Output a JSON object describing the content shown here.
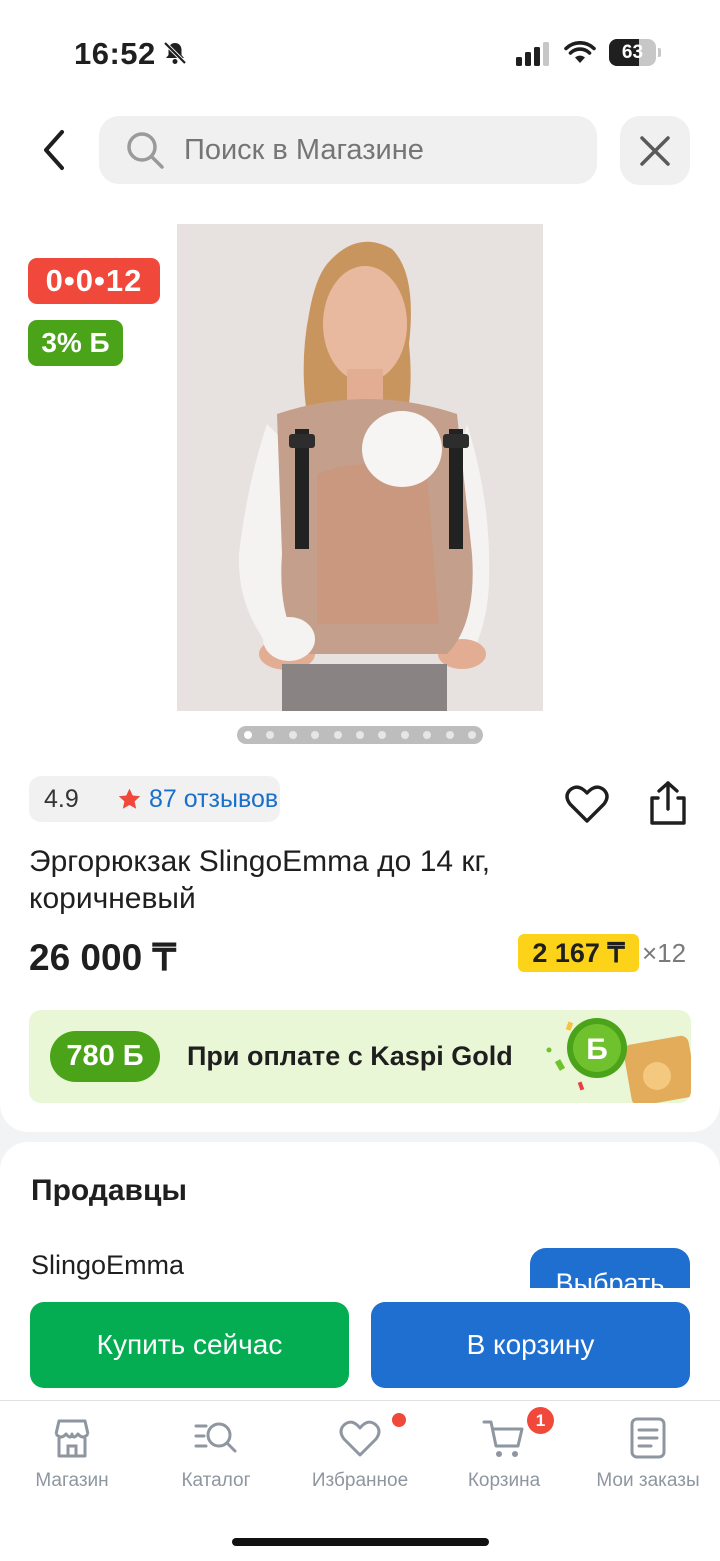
{
  "status_bar": {
    "time": "16:52",
    "battery": "63",
    "battery_level": 0.63
  },
  "header": {
    "search_placeholder": "Поиск в Магазине"
  },
  "product": {
    "badge_installment": "0•0•12",
    "badge_bonus": "3% Б",
    "gallery_total": 11,
    "gallery_active": 1,
    "rating": "4.9",
    "reviews": "87 отзывов",
    "title": "Эргорюкзак SlingoEmma до 14 кг, коричневый",
    "price": "26 000 ₸",
    "monthly_price": "2 167 ₸",
    "monthly_times": "×12"
  },
  "gold_banner": {
    "bonus": "780 Б",
    "text": "При оплате с Kaspi Gold",
    "art_letter": "Б"
  },
  "sellers": {
    "title": "Продавцы",
    "seller_name": "SlingoEmma",
    "choose_label": "Выбрать"
  },
  "actions": {
    "buy_now": "Купить сейчас",
    "add_to_cart": "В корзину"
  },
  "tabs": [
    {
      "label": "Магазин",
      "icon": "store-icon"
    },
    {
      "label": "Каталог",
      "icon": "catalog-icon"
    },
    {
      "label": "Избранное",
      "icon": "heart-icon"
    },
    {
      "label": "Корзина",
      "icon": "cart-icon",
      "badge": "1"
    },
    {
      "label": "Мои заказы",
      "icon": "orders-icon"
    }
  ],
  "colors": {
    "accent_blue": "#1f6fd0",
    "buy_green": "#04ad52",
    "badge_red": "#f0493c",
    "bonus_green": "#4ba31a",
    "monthly_yellow": "#fcd319"
  }
}
